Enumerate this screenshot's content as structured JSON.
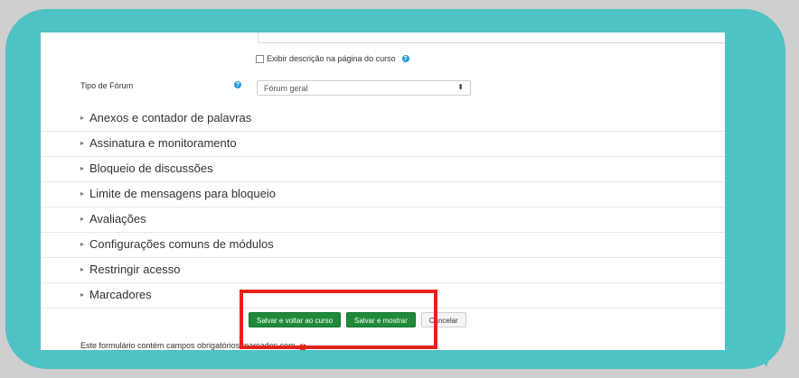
{
  "form": {
    "show_description_label": "Exibir descrição na página do curso",
    "forum_type_label": "Tipo de Fórum",
    "forum_type_value": "Fórum geral",
    "sections": [
      "Anexos e contador de palavras",
      "Assinatura e monitoramento",
      "Bloqueio de discussões",
      "Limite de mensagens para bloqueio",
      "Avaliações",
      "Configurações comuns de módulos",
      "Restringir acesso",
      "Marcadores"
    ],
    "buttons": {
      "save_return": "Salvar e voltar ao curso",
      "save_display": "Salvar e mostrar",
      "cancel": "Cancelar"
    },
    "required_note": "Este formulário contém campos obrigatórios marcados com"
  },
  "icons": {
    "help": "question-circle-icon",
    "required": "exclamation-circle-icon",
    "collapsed": "caret-right-icon",
    "select": "select-arrows-icon"
  },
  "colors": {
    "bubble": "#4ec2c4",
    "primary_button": "#1f8a3a",
    "highlight": "#e3231b",
    "help_icon": "#1a9bd6"
  }
}
